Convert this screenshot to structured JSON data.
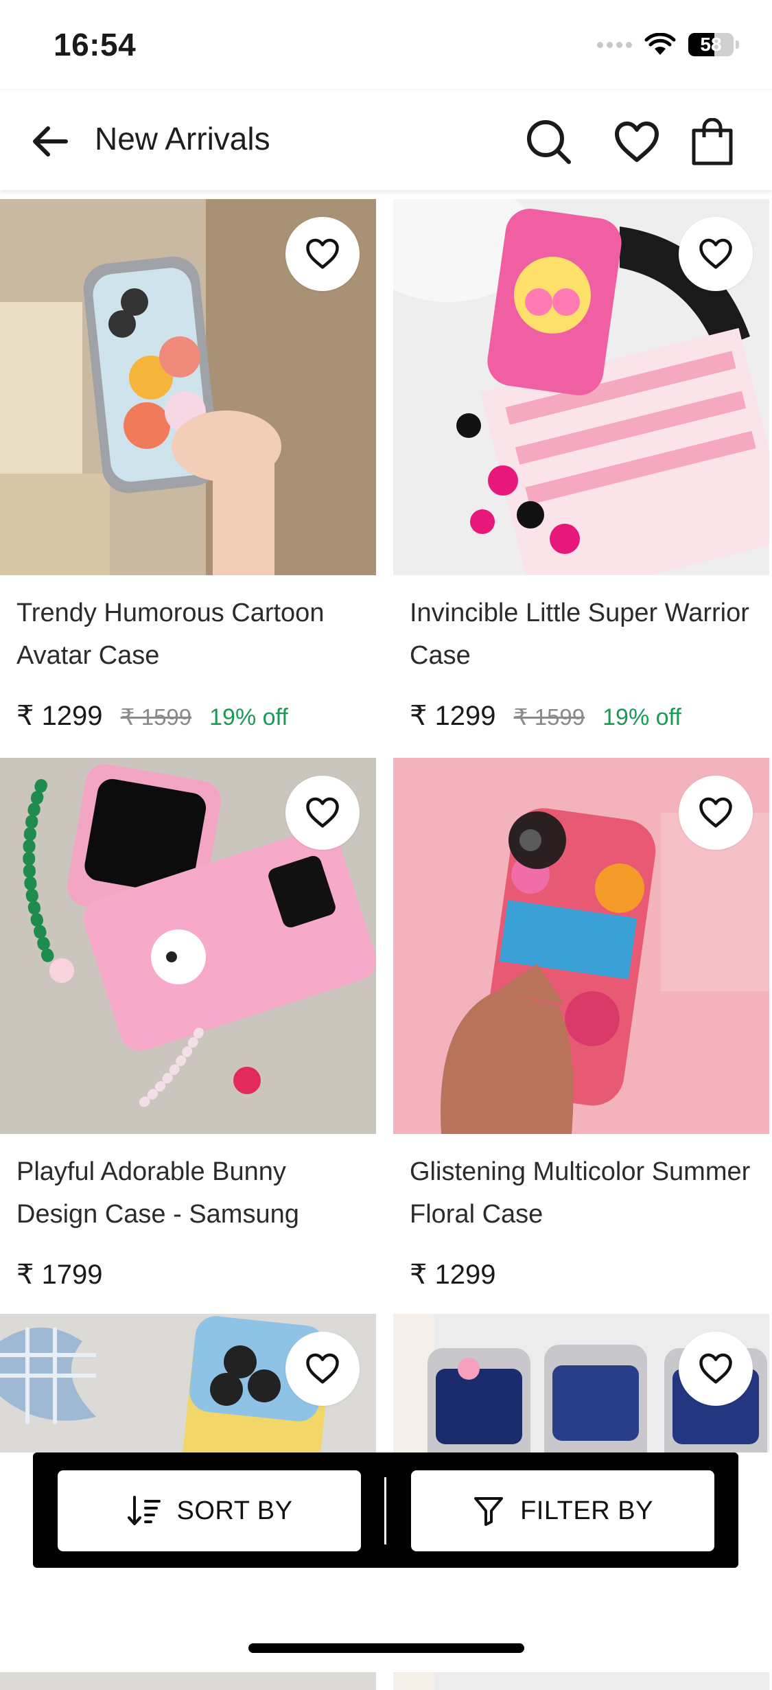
{
  "status_bar": {
    "time": "16:54",
    "battery": "58",
    "battery_level": 0.58
  },
  "header": {
    "title": "New Arrivals"
  },
  "products": [
    {
      "name": "Trendy Humorous Cartoon Avatar Case",
      "price": "₹ 1299",
      "mrp": "₹ 1599",
      "discount": "19% off"
    },
    {
      "name": "Invincible Little Super Warrior Case",
      "price": "₹ 1299",
      "mrp": "₹ 1599",
      "discount": "19% off"
    },
    {
      "name": "Playful Adorable Bunny Design Case - Samsung",
      "price": "₹ 1799",
      "mrp": "",
      "discount": ""
    },
    {
      "name": "Glistening Multicolor Summer Floral Case",
      "price": "₹ 1299",
      "mrp": "",
      "discount": ""
    },
    {
      "name": "",
      "price": "",
      "mrp": "",
      "discount": ""
    },
    {
      "name": "",
      "price": "",
      "mrp": "",
      "discount": ""
    }
  ],
  "bottom_bar": {
    "sort_label": "SORT BY",
    "filter_label": "FILTER BY"
  },
  "colors": {
    "discount": "#1a9a55",
    "accent": "#000000"
  }
}
